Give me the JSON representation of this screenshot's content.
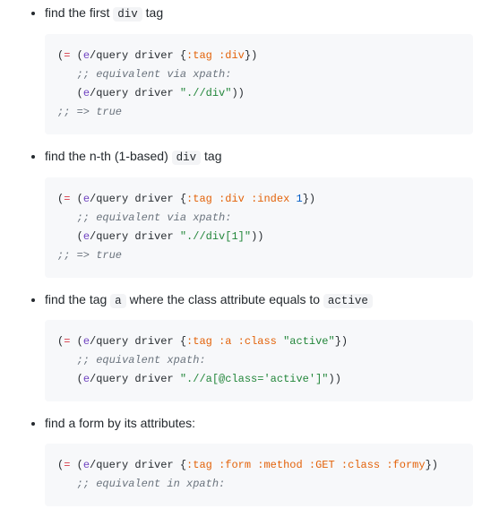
{
  "items": [
    {
      "desc_pre": "find the first ",
      "desc_code": "div",
      "desc_post": " tag",
      "code_html": "<span class=\"tk-paren\">(</span><span class=\"tk-op\">=</span> <span class=\"tk-paren\">(</span><span class=\"tk-ns\">e</span>/<span class=\"tk-name\">query</span> driver <span class=\"tk-paren\">{</span><span class=\"tk-key\">:tag</span> <span class=\"tk-key\">:div</span><span class=\"tk-paren\">}</span><span class=\"tk-paren\">)</span>\n   <span class=\"tk-comment\">;; equivalent via xpath:</span>\n   <span class=\"tk-paren\">(</span><span class=\"tk-ns\">e</span>/<span class=\"tk-name\">query</span> driver <span class=\"tk-str\">\".//div\"</span><span class=\"tk-paren\">)</span><span class=\"tk-paren\">)</span>\n<span class=\"tk-comment\">;; =&gt; true</span>"
    },
    {
      "desc_pre": "find the n-th (1-based) ",
      "desc_code": "div",
      "desc_post": " tag",
      "code_html": "<span class=\"tk-paren\">(</span><span class=\"tk-op\">=</span> <span class=\"tk-paren\">(</span><span class=\"tk-ns\">e</span>/<span class=\"tk-name\">query</span> driver <span class=\"tk-paren\">{</span><span class=\"tk-key\">:tag</span> <span class=\"tk-key\">:div</span> <span class=\"tk-key\">:index</span> <span class=\"tk-num\">1</span><span class=\"tk-paren\">}</span><span class=\"tk-paren\">)</span>\n   <span class=\"tk-comment\">;; equivalent via xpath:</span>\n   <span class=\"tk-paren\">(</span><span class=\"tk-ns\">e</span>/<span class=\"tk-name\">query</span> driver <span class=\"tk-str\">\".//div[1]\"</span><span class=\"tk-paren\">)</span><span class=\"tk-paren\">)</span>\n<span class=\"tk-comment\">;; =&gt; true</span>"
    },
    {
      "desc_pre": "find the tag ",
      "desc_code": "a",
      "desc_post": " where the class attribute equals to ",
      "desc_code2": "active",
      "code_html": "<span class=\"tk-paren\">(</span><span class=\"tk-op\">=</span> <span class=\"tk-paren\">(</span><span class=\"tk-ns\">e</span>/<span class=\"tk-name\">query</span> driver <span class=\"tk-paren\">{</span><span class=\"tk-key\">:tag</span> <span class=\"tk-key\">:a</span> <span class=\"tk-key\">:class</span> <span class=\"tk-str\">\"active\"</span><span class=\"tk-paren\">}</span><span class=\"tk-paren\">)</span>\n   <span class=\"tk-comment\">;; equivalent xpath:</span>\n   <span class=\"tk-paren\">(</span><span class=\"tk-ns\">e</span>/<span class=\"tk-name\">query</span> driver <span class=\"tk-str\">\".//a[@class='active']\"</span><span class=\"tk-paren\">)</span><span class=\"tk-paren\">)</span>"
    },
    {
      "desc_pre": "find a form by its attributes:",
      "desc_code": "",
      "desc_post": "",
      "code_html": "<span class=\"tk-paren\">(</span><span class=\"tk-op\">=</span> <span class=\"tk-paren\">(</span><span class=\"tk-ns\">e</span>/<span class=\"tk-name\">query</span> driver <span class=\"tk-paren\">{</span><span class=\"tk-key\">:tag</span> <span class=\"tk-key\">:form</span> <span class=\"tk-key\">:method</span> <span class=\"tk-key\">:GET</span> <span class=\"tk-key\">:class</span> <span class=\"tk-key\">:formy</span><span class=\"tk-paren\">}</span><span class=\"tk-paren\">)</span>\n   <span class=\"tk-comment\">;; equivalent in xpath:</span>"
    }
  ]
}
